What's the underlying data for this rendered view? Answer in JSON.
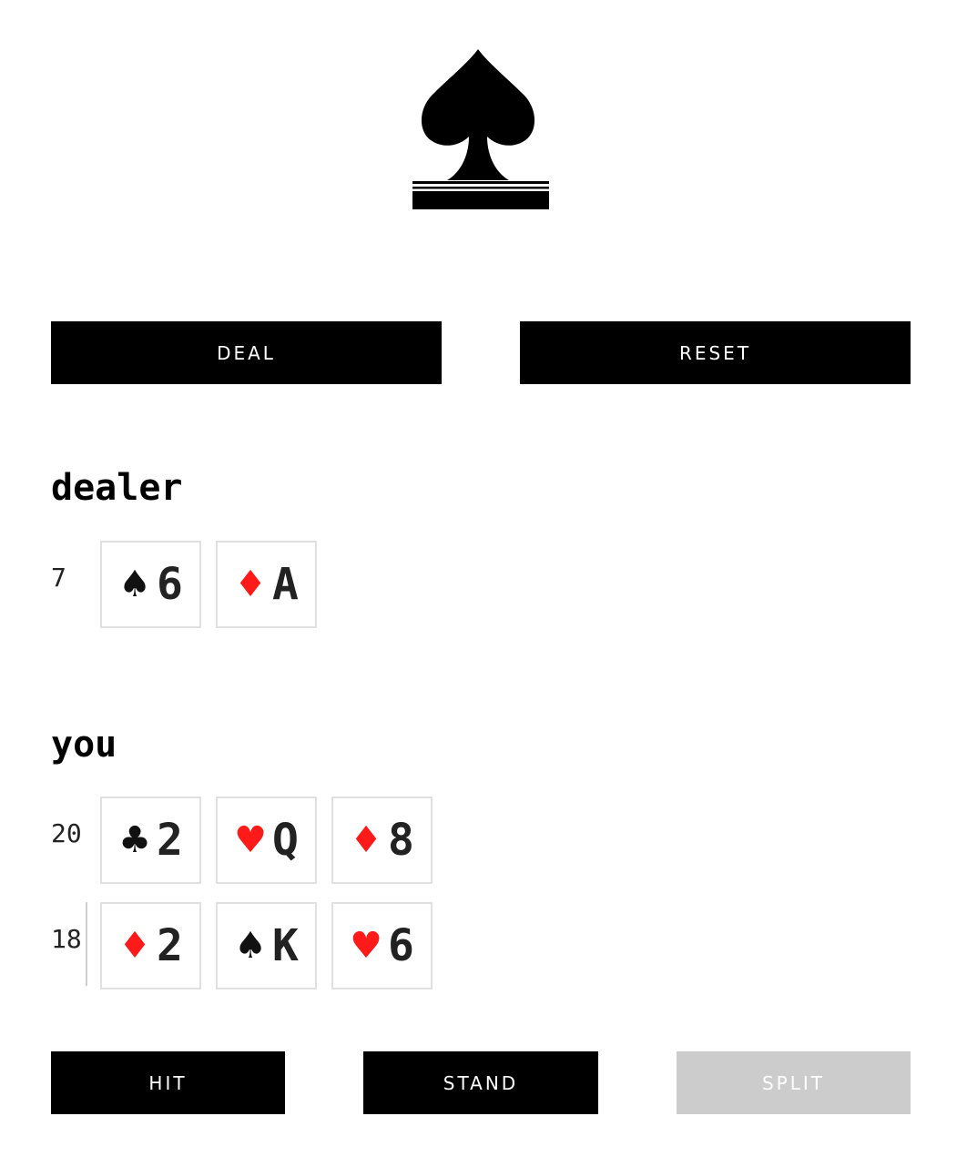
{
  "buttons": {
    "deal": "DEAL",
    "reset": "RESET",
    "hit": "HIT",
    "stand": "STAND",
    "split": "SPLIT"
  },
  "dealer": {
    "title": "dealer",
    "score": "7",
    "cards": [
      {
        "suit": "♠",
        "suit_name": "spades",
        "color": "black",
        "rank": "6"
      },
      {
        "suit": "♦",
        "suit_name": "diamonds",
        "color": "red",
        "rank": "A"
      }
    ]
  },
  "player": {
    "title": "you",
    "hands": [
      {
        "score": "20",
        "cards": [
          {
            "suit": "♣",
            "suit_name": "clubs",
            "color": "black",
            "rank": "2"
          },
          {
            "suit": "♥",
            "suit_name": "hearts",
            "color": "red",
            "rank": "Q"
          },
          {
            "suit": "♦",
            "suit_name": "diamonds",
            "color": "red",
            "rank": "8"
          }
        ]
      },
      {
        "score": "18",
        "cards": [
          {
            "suit": "♦",
            "suit_name": "diamonds",
            "color": "red",
            "rank": "2"
          },
          {
            "suit": "♠",
            "suit_name": "spades",
            "color": "black",
            "rank": "K"
          },
          {
            "suit": "♥",
            "suit_name": "hearts",
            "color": "red",
            "rank": "6"
          }
        ]
      }
    ]
  },
  "colors": {
    "red_suit": "#ff1a1a",
    "black_suit": "#111111",
    "button_bg": "#000000",
    "button_disabled_bg": "#cccccc"
  },
  "icons": {
    "logo": "spade-logo-icon"
  }
}
